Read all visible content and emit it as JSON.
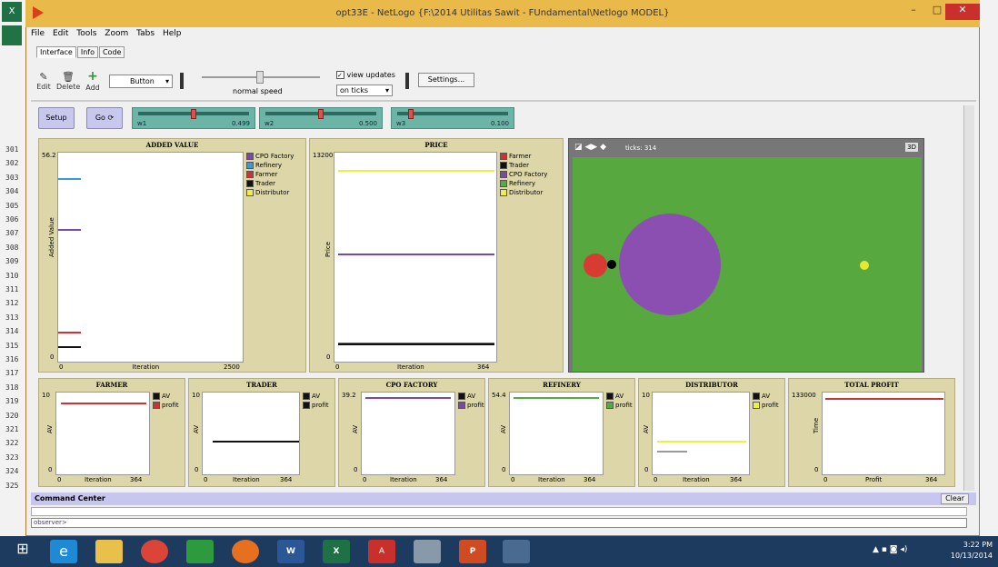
{
  "window": {
    "title": "opt33E - NetLogo {F:\\2014 Utilitas Sawit - FUndamental\\Netlogo MODEL}"
  },
  "menu": [
    "File",
    "Edit",
    "Tools",
    "Zoom",
    "Tabs",
    "Help"
  ],
  "tabs": [
    "Interface",
    "Info",
    "Code"
  ],
  "toolbar": {
    "edit": "Edit",
    "delete": "Delete",
    "add": "Add",
    "widget_select": "Button",
    "speed_label": "normal speed",
    "view_updates": "view updates",
    "update_mode": "on ticks",
    "settings": "Settings..."
  },
  "buttons": {
    "setup": "Setup",
    "go": "Go"
  },
  "sliders": [
    {
      "label": "w1",
      "value": "0.499",
      "level": 0.5
    },
    {
      "label": "w2",
      "value": "0.500",
      "level": 0.5
    },
    {
      "label": "w3",
      "value": "0.100",
      "level": 0.1
    }
  ],
  "view": {
    "ticks": "ticks: 314",
    "zoom": "3D"
  },
  "plots": {
    "added_value": {
      "title": "ADDED VALUE",
      "ymax": "56.2",
      "ymin": "0",
      "xmin": "0",
      "xmax": "2500",
      "xlabel": "Iteration",
      "ylabel": "Added Value",
      "legend": [
        {
          "name": "CPO Factory",
          "color": "#7b4aa0"
        },
        {
          "name": "Refinery",
          "color": "#3a9bd0"
        },
        {
          "name": "Farmer",
          "color": "#cc3333"
        },
        {
          "name": "Trader",
          "color": "#111111"
        },
        {
          "name": "Distributor",
          "color": "#eeee44"
        }
      ]
    },
    "price": {
      "title": "PRICE",
      "ymax": "13200",
      "ymin": "0",
      "xmin": "0",
      "xmax": "364",
      "xlabel": "Iteration",
      "ylabel": "Price",
      "legend": [
        {
          "name": "Farmer",
          "color": "#cc3333"
        },
        {
          "name": "Trader",
          "color": "#111111"
        },
        {
          "name": "CPO Factory",
          "color": "#7b4aa0"
        },
        {
          "name": "Refinery",
          "color": "#55aa44"
        },
        {
          "name": "Distributor",
          "color": "#eeee44"
        }
      ]
    },
    "farmer": {
      "title": "FARMER",
      "ymax": "10",
      "ymin": "0",
      "xmin": "0",
      "xmax": "364",
      "xlabel": "Iteration",
      "ylabel": "AV",
      "legend": [
        {
          "name": "AV",
          "color": "#111111"
        },
        {
          "name": "profit",
          "color": "#cc3333"
        }
      ]
    },
    "trader": {
      "title": "TRADER",
      "ymax": "10",
      "ymin": "0",
      "xmin": "0",
      "xmax": "364",
      "xlabel": "Iteration",
      "ylabel": "AV",
      "legend": [
        {
          "name": "AV",
          "color": "#111111"
        },
        {
          "name": "profit",
          "color": "#111111"
        }
      ]
    },
    "cpo": {
      "title": "CPO FACTORY",
      "ymax": "39.2",
      "ymin": "0",
      "xmin": "0",
      "xmax": "364",
      "xlabel": "Iteration",
      "ylabel": "AV",
      "legend": [
        {
          "name": "AV",
          "color": "#111111"
        },
        {
          "name": "profit",
          "color": "#7b4aa0"
        }
      ]
    },
    "refinery": {
      "title": "REFINERY",
      "ymax": "54.4",
      "ymin": "0",
      "xmin": "0",
      "xmax": "364",
      "xlabel": "Iteration",
      "ylabel": "AV",
      "legend": [
        {
          "name": "AV",
          "color": "#111111"
        },
        {
          "name": "profit",
          "color": "#55aa44"
        }
      ]
    },
    "distributor": {
      "title": "DISTRIBUTOR",
      "ymax": "10",
      "ymin": "0",
      "xmin": "0",
      "xmax": "364",
      "xlabel": "Iteration",
      "ylabel": "AV",
      "legend": [
        {
          "name": "AV",
          "color": "#111111"
        },
        {
          "name": "profit",
          "color": "#eeee44"
        }
      ]
    },
    "total": {
      "title": "TOTAL PROFIT",
      "ymax": "133000",
      "ymin": "0",
      "xmin": "0",
      "xmax": "364",
      "xlabel": "Profit",
      "ylabel": "Time"
    }
  },
  "command_center": {
    "title": "Command Center",
    "clear": "Clear",
    "prompt": "observer>"
  },
  "excel": {
    "rows": [
      "301",
      "302",
      "303",
      "304",
      "305",
      "306",
      "307",
      "308",
      "309",
      "310",
      "311",
      "312",
      "313",
      "314",
      "315",
      "316",
      "317",
      "318",
      "319",
      "320",
      "321",
      "322",
      "323",
      "324",
      "325"
    ]
  },
  "taskbar": {
    "time": "3:22 PM",
    "date": "10/13/2014"
  },
  "colors": {
    "title_bar": "#e9b94a",
    "world": "#57a83e",
    "plot_bg": "#dcd6a8",
    "button": "#c8c8ee",
    "slider": "#6cb5a6"
  }
}
